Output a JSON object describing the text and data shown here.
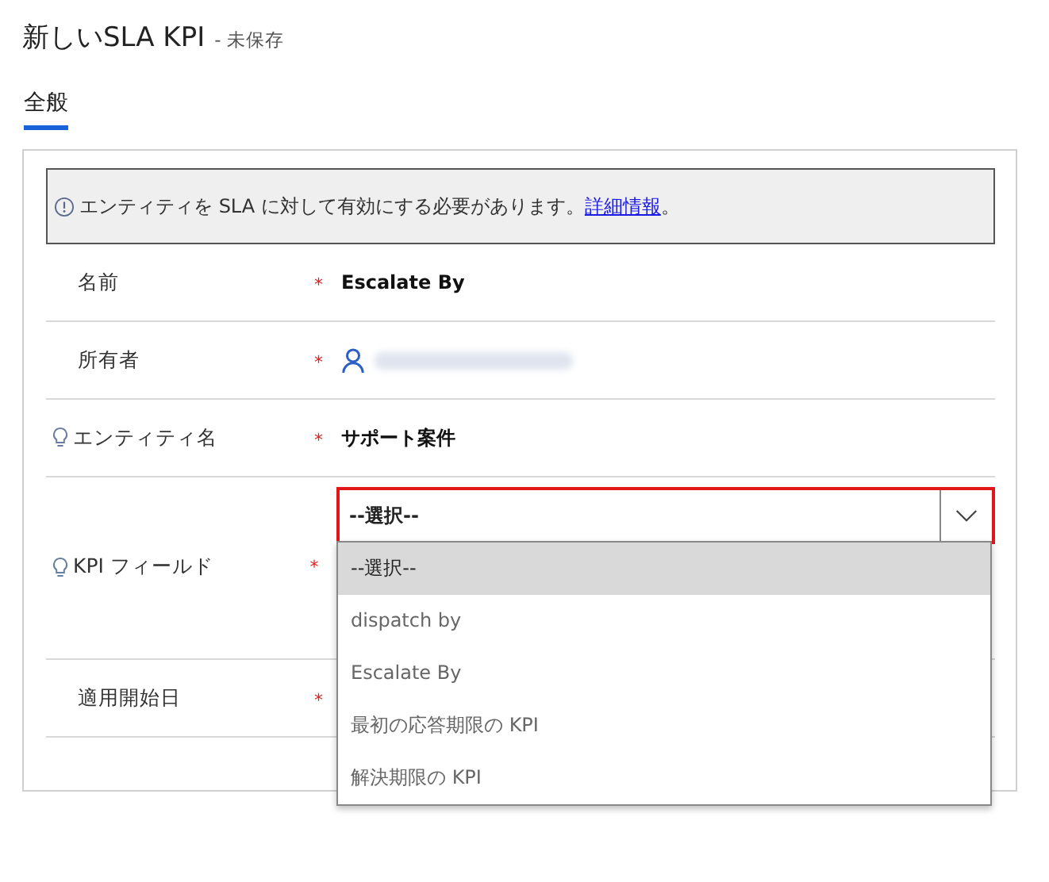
{
  "header": {
    "title": "新しいSLA KPI",
    "status": "- 未保存"
  },
  "tabs": [
    {
      "label": "全般",
      "selected": true
    }
  ],
  "notice": {
    "text": "エンティティを SLA に対して有効にする必要があります。",
    "link": "詳細情報",
    "end": "。"
  },
  "fields": [
    {
      "kind": "text",
      "label": "名前",
      "hint": false,
      "required_mark": "*",
      "value": "Escalate By"
    },
    {
      "kind": "lookup",
      "label": "所有者",
      "hint": false,
      "required_mark": "*"
    },
    {
      "kind": "text",
      "label": "エンティティ名",
      "hint": true,
      "required_mark": "*",
      "value": "サポート案件"
    },
    {
      "kind": "select",
      "label": "KPI フィールド",
      "hint": true,
      "required_mark": "*",
      "value": "--選択--",
      "expanded": true,
      "options": [
        {
          "label": "--選択--",
          "selected": true
        },
        {
          "label": "dispatch by",
          "selected": false
        },
        {
          "label": "Escalate By",
          "selected": false
        },
        {
          "label": "最初の応答期限の KPI",
          "selected": false
        },
        {
          "label": "解決期限の KPI",
          "selected": false
        }
      ]
    },
    {
      "kind": "text",
      "label": "適用開始日",
      "hint": false,
      "required_mark": "*"
    }
  ]
}
